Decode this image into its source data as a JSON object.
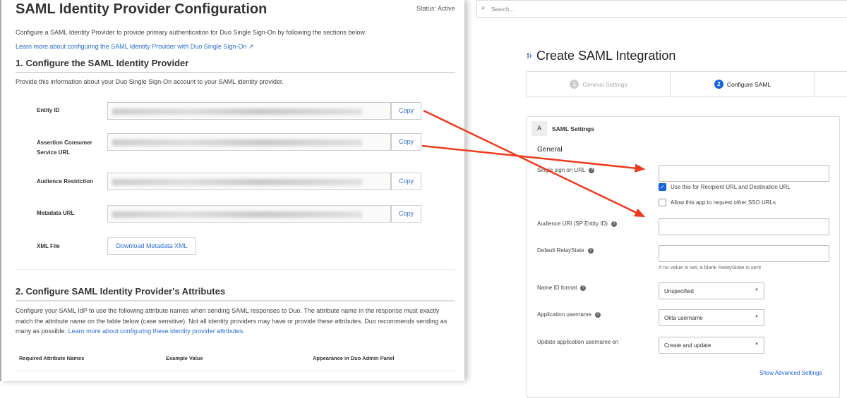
{
  "left": {
    "title": "SAML Identity Provider Configuration",
    "status": "Status: Active",
    "intro": "Configure a SAML Identity Provider to provide primary authentication for Duo Single Sign-On by following the sections below.",
    "intro_link": "Learn more about configuring the SAML Identity Provider with Duo Single Sign-On",
    "section1": {
      "heading": "1. Configure the SAML Identity Provider",
      "desc": "Provide this information about your Duo Single Sign-On account to your SAML identity provider.",
      "fields": [
        {
          "label": "Entity ID",
          "copy": "Copy"
        },
        {
          "label": "Assertion Consumer Service URL",
          "copy": "Copy"
        },
        {
          "label": "Audience Restriction",
          "copy": "Copy"
        },
        {
          "label": "Metadata URL",
          "copy": "Copy"
        }
      ],
      "xml_label": "XML File",
      "xml_button": "Download Metadata XML"
    },
    "section2": {
      "heading": "2. Configure SAML Identity Provider's Attributes",
      "desc": "Configure your SAML IdP to use the following attribute names when sending SAML responses to Duo. The attribute name in the response must exactly match the attribute name on the table below (case sensitive). Not all identity providers may have or provide these attributes. Duo recommends sending as many as possible.",
      "link": "Learn more about configuring these identity provider attributes.",
      "columns": [
        "Required Attribute Names",
        "Example Value",
        "Appearance in Duo Admin Panel"
      ]
    }
  },
  "right": {
    "search_placeholder": "Search...",
    "title": "Create SAML Integration",
    "tabs": [
      {
        "num": "1",
        "label": "General Settings"
      },
      {
        "num": "2",
        "label": "Configure SAML"
      }
    ],
    "section_letter": "A",
    "section_title": "SAML Settings",
    "group": "General",
    "sso_label": "Single sign on URL",
    "cb1": "Use this for Recipient URL and Destination URL",
    "cb2": "Allow this app to request other SSO URLs",
    "audience_label": "Audience URI (SP Entity ID)",
    "relay_label": "Default RelayState",
    "relay_hint": "If no value is set, a blank RelayState is sent",
    "nameid_label": "Name ID format",
    "nameid_value": "Unspecified",
    "appuser_label": "Application username",
    "appuser_value": "Okta username",
    "update_label": "Update application username on",
    "update_value": "Create and update",
    "advanced": "Show Advanced Settings"
  },
  "colors": {
    "accent": "#2b6fcf",
    "okta_blue": "#1662dd",
    "arrow": "#f03a1e"
  }
}
